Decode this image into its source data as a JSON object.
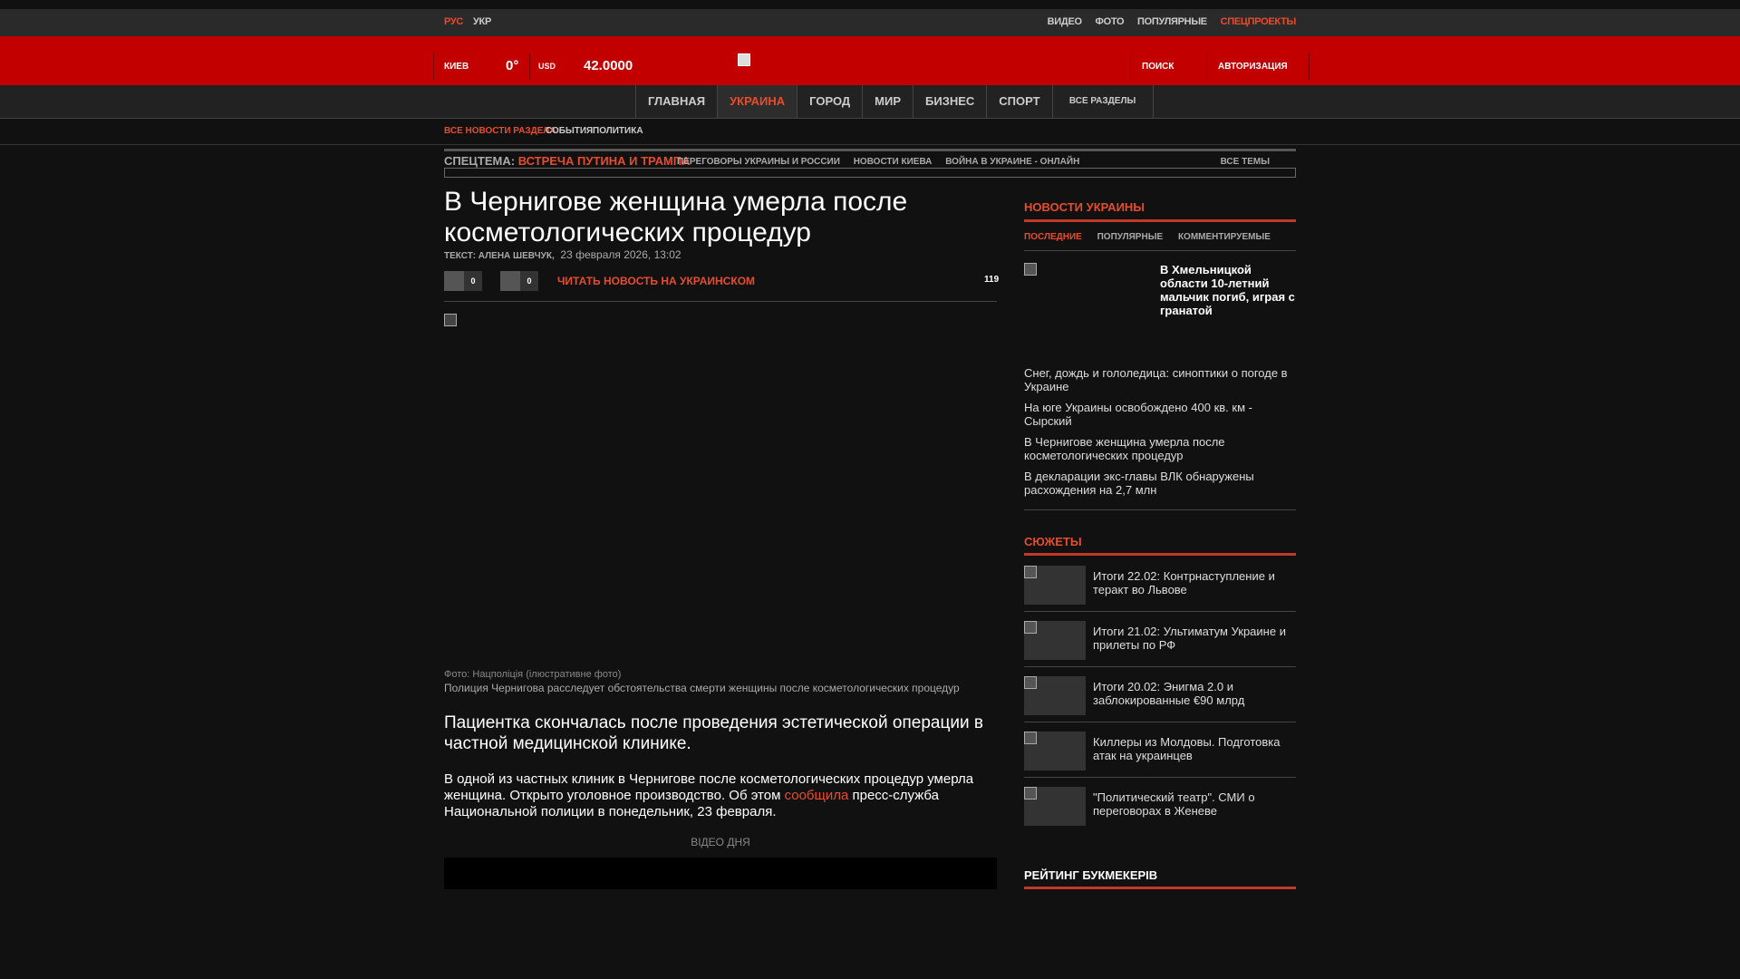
{
  "lang": {
    "rus": "РУС",
    "ukr": "УКР"
  },
  "toplinks": [
    "ВИДЕО",
    "ФОТО",
    "ПОПУЛЯРНЫЕ",
    "СПЕЦПРОЕКТЫ"
  ],
  "header": {
    "city": "КИЕВ",
    "temp": "0°",
    "currency": "USD",
    "rate": "42.0000",
    "search": "ПОИСК",
    "auth": "АВТОРИЗАЦИЯ"
  },
  "nav": [
    "ГЛАВНАЯ",
    "УКРАИНА",
    "ГОРОД",
    "МИР",
    "БИЗНЕС",
    "СПОРТ",
    "ВСЕ РАЗДЕЛЫ"
  ],
  "subnav": [
    "ВСЕ НОВОСТИ РАЗДЕЛА",
    "СОБЫТИЯ",
    "ПОЛИТИКА"
  ],
  "spec": {
    "label": "СПЕЦТЕМА:",
    "topic": "ВСТРЕЧА ПУТИНА И ТРАМПА",
    "links": [
      "ПЕРЕГОВОРЫ УКРАИНЫ И РОССИИ",
      "НОВОСТИ КИЕВА",
      "ВОЙНА В УКРАИНЕ - ОНЛАЙН"
    ],
    "all": "ВСЕ ТЕМЫ"
  },
  "article": {
    "title": "В Чернигове женщина умерла после косметологических процедур",
    "author": "ТЕКСТ: АЛЕНА ШЕВЧУК,",
    "date": "23 февраля 2026, 13:02",
    "share1": "0",
    "share2": "0",
    "read_ukr": "ЧИТАТЬ НОВОСТЬ НА УКРАИНСКОМ",
    "views": "119",
    "photo_credit": "Фото: Нацполіція (ілюстративне фото)",
    "caption": "Полиция Чернигова расследует обстоятельства смерти женщины после косметологических процедур",
    "lead": "Пациентка скончалась после проведения эстетической операции в частной медицинской клинике.",
    "body_pre": "В одной из частных клиник в Чернигове после косметологических процедур умерла женщина. Открыто уголовное производство. Об этом ",
    "body_link": "сообщила",
    "body_post": " пресс-служба Национальной полиции в понедельник, 23 февраля.",
    "video_day": "ВІДЕО ДНЯ"
  },
  "sidebar": {
    "news_title": "НОВОСТИ УКРАИНЫ",
    "tabs": [
      "ПОСЛЕДНИЕ",
      "ПОПУЛЯРНЫЕ",
      "КОММЕНТИРУЕМЫЕ"
    ],
    "top_item": "В Хмельницкой области 10-летний мальчик погиб, играя с гранатой",
    "items": [
      "Снег, дождь и гололедица: синоптики о погоде в Украине",
      "На юге Украины освобождено 400 кв. км - Сырский",
      "В Чернигове женщина умерла после косметологических процедур",
      "В декларации экс-главы ВЛК обнаружены расхождения на 2,7 млн"
    ],
    "stories_title": "СЮЖЕТЫ",
    "stories": [
      "Итоги 22.02: Контрнаступление и теракт во Львове",
      "Итоги 21.02: Ультиматум Украине и прилеты по РФ",
      "Итоги 20.02: Энигма 2.0 и заблокированные €90 млрд",
      "Киллеры из Молдовы. Подготовка атак на украинцев",
      "\"Политический театр\". СМИ о переговорах в Женеве"
    ],
    "rating_title": "РЕЙТИНГ БУКМЕКЕРІВ"
  }
}
